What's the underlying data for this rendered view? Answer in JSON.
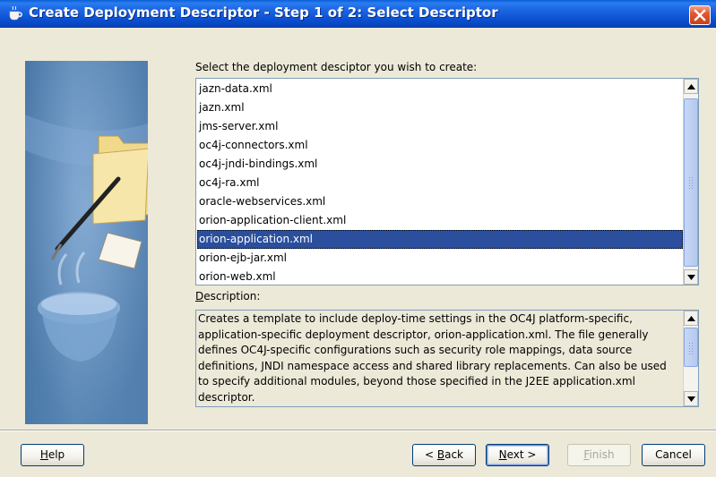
{
  "window": {
    "title": "Create Deployment Descriptor - Step 1 of 2: Select Descriptor"
  },
  "list": {
    "label": "Select the deployment desciptor you wish to create:",
    "items": [
      "jazn-data.xml",
      "jazn.xml",
      "jms-server.xml",
      "oc4j-connectors.xml",
      "oc4j-jndi-bindings.xml",
      "oc4j-ra.xml",
      "oracle-webservices.xml",
      "orion-application-client.xml",
      "orion-application.xml",
      "orion-ejb-jar.xml",
      "orion-web.xml"
    ],
    "selected_index": 8
  },
  "description": {
    "label_mnemonic": "D",
    "label_rest": "escription:",
    "text": "Creates a template to include deploy-time settings in the OC4J platform-specific, application-specific deployment descriptor, orion-application.xml. The file generally defines OC4J-specific configurations such as security role mappings, data source definitions, JNDI namespace access and shared library replacements. Can also be used to specify additional modules, beyond those specified in the J2EE application.xml descriptor."
  },
  "buttons": {
    "help": {
      "mnemonic": "H",
      "rest": "elp"
    },
    "back": {
      "prefix": "< ",
      "mnemonic": "B",
      "rest": "ack"
    },
    "next": {
      "mnemonic": "N",
      "rest": "ext >"
    },
    "finish": {
      "mnemonic": "F",
      "rest": "inish",
      "enabled": false
    },
    "cancel": {
      "label": "Cancel"
    }
  },
  "icons": {
    "title": "coffee-cup-icon",
    "close": "close-icon",
    "side": "wizard-folder-illustration"
  },
  "colors": {
    "titlebar": "#0a4fd0",
    "selection": "#2b4f9c",
    "close": "#e2582f"
  }
}
